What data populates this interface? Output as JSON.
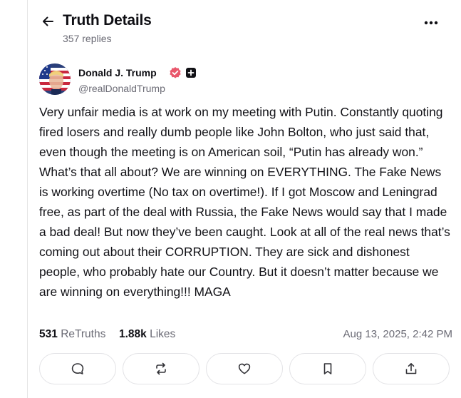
{
  "header": {
    "title": "Truth Details",
    "reply_count": "357 replies",
    "back_icon": "arrow-left-icon",
    "more_icon": "more-horizontal-icon"
  },
  "author": {
    "name": "Donald J. Trump",
    "handle": "@realDonaldTrump",
    "avatar": "avatar-flag-portrait",
    "badges": [
      "verified-badge-icon",
      "plus-badge-icon"
    ],
    "verified_color": "#e9566b"
  },
  "post": {
    "text": "Very unfair media is at work on my meeting with Putin. Constantly quoting fired losers and really dumb people like John Bolton, who just said that, even though the meeting is on American soil, “Putin has already won.” What’s that all about? We are winning on EVERYTHING. The Fake News is working overtime (No tax on overtime!). If I got Moscow and Leningrad free, as part of the deal with Russia, the Fake News would say that I made a bad deal! But now they’ve been caught. Look at all of the real news that’s coming out about their CORRUPTION. They are sick and dishonest people, who probably hate our Country. But it doesn’t matter because we are winning on everything!!! MAGA"
  },
  "stats": {
    "retruths_count": "531",
    "retruths_label": "ReTruths",
    "likes_count": "1.88k",
    "likes_label": "Likes",
    "timestamp": "Aug 13, 2025, 2:42 PM"
  },
  "actions": [
    {
      "name": "reply-button",
      "icon": "comment-icon"
    },
    {
      "name": "retruth-button",
      "icon": "repost-icon"
    },
    {
      "name": "like-button",
      "icon": "heart-icon"
    },
    {
      "name": "bookmark-button",
      "icon": "bookmark-icon"
    },
    {
      "name": "share-button",
      "icon": "share-icon"
    }
  ]
}
